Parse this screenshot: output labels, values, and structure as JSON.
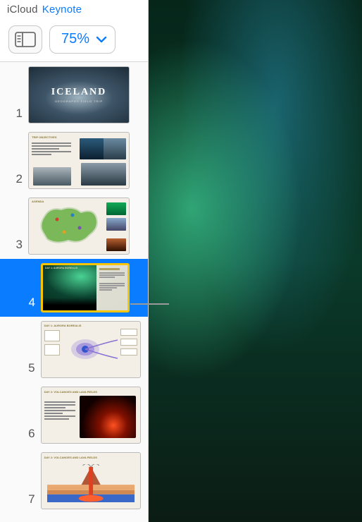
{
  "header": {
    "app_group": "iCloud",
    "app_name": "Keynote"
  },
  "toolbar": {
    "zoom_level": "75%"
  },
  "slides": [
    {
      "number": "1",
      "title": "ICELAND",
      "subtitle": "GEOGRAPHY FIELD TRIP"
    },
    {
      "number": "2",
      "heading": "TRIP OBJECTIVES"
    },
    {
      "number": "3",
      "heading": "AGENDA"
    },
    {
      "number": "4",
      "heading": "DAY 1: AURORA BOREALIS",
      "selected": true
    },
    {
      "number": "5",
      "heading": "DAY 1: AURORA BOREALIS"
    },
    {
      "number": "6",
      "heading": "DAY 2: VOLCANOES AND LAVA FIELDS"
    },
    {
      "number": "7",
      "heading": "DAY 2: VOLCANOES AND LAVA FIELDS"
    }
  ]
}
